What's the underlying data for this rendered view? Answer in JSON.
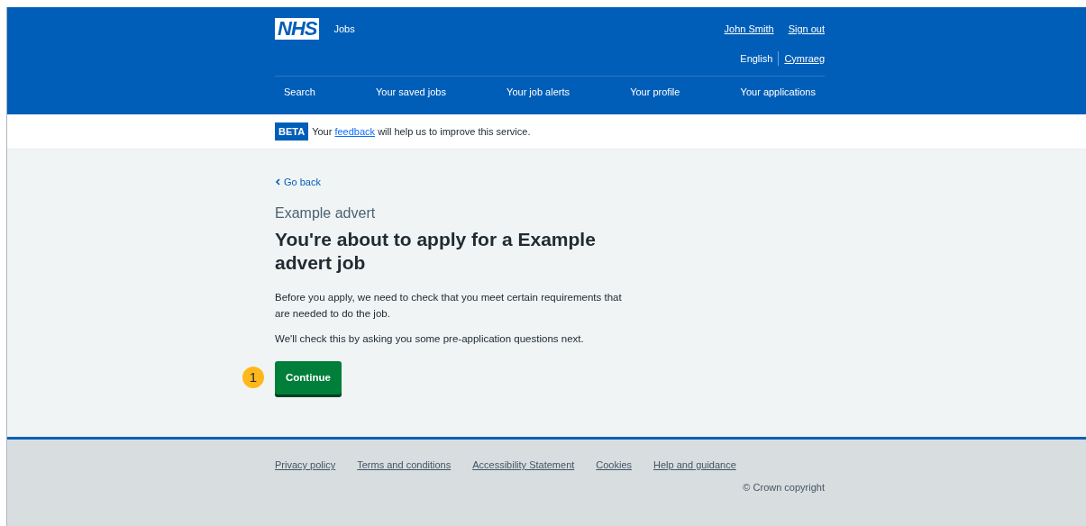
{
  "header": {
    "logo": "NHS",
    "service": "Jobs",
    "account_links": [
      "John Smith",
      "Sign out"
    ],
    "languages": [
      {
        "label": "English",
        "selected": true
      },
      {
        "label": "Cymraeg",
        "selected": false
      }
    ],
    "nav": [
      "Search",
      "Your saved jobs",
      "Your job alerts",
      "Your profile",
      "Your applications"
    ]
  },
  "banner": {
    "tag": "BETA",
    "text": "Your ",
    "link": "feedback",
    "text_after": " will help us to improve this service."
  },
  "main": {
    "back_link": "Go back",
    "caption": "Example advert",
    "heading": "You're about to apply for a Example advert job",
    "paragraphs": [
      "Before you apply, we need to check that you meet certain requirements that are needed to do the job.",
      "We'll check this by asking you some pre-application questions next."
    ],
    "callout": "1",
    "button": "Continue"
  },
  "footer": {
    "links": [
      "Privacy policy",
      "Terms and conditions",
      "Accessibility Statement",
      "Cookies",
      "Help and guidance"
    ],
    "copyright": "© Crown copyright"
  }
}
